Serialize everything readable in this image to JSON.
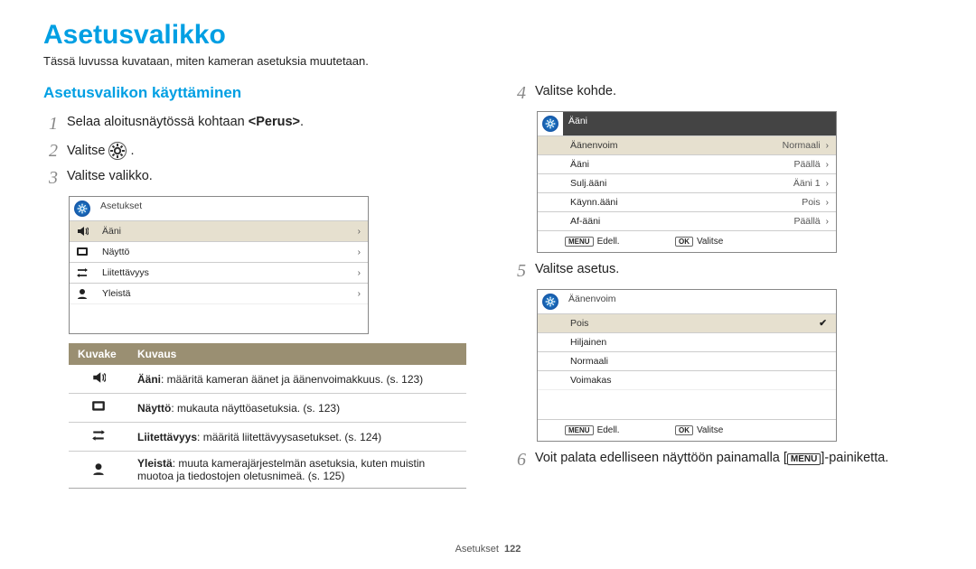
{
  "header": {
    "title": "Asetusvalikko",
    "intro": "Tässä luvussa kuvataan, miten kameran asetuksia muutetaan."
  },
  "section_heading": "Asetusvalikon käyttäminen",
  "steps": {
    "s1_pre": "Selaa aloitusnäytössä kohtaan ",
    "s1_bold": "<Perus>",
    "s1_post": ".",
    "s2_pre": "Valitse ",
    "s2_post": ".",
    "s3": "Valitse valikko.",
    "s4": "Valitse kohde.",
    "s5": "Valitse asetus.",
    "s6_pre": "Voit palata edelliseen näyttöön painamalla [",
    "s6_post": "]-painiketta.",
    "s6_badge": "MENU"
  },
  "cam1": {
    "title": "Asetukset",
    "rows": [
      {
        "label": "Ääni",
        "active": true
      },
      {
        "label": "Näyttö"
      },
      {
        "label": "Liitettävyys"
      },
      {
        "label": "Yleistä"
      }
    ]
  },
  "cam2": {
    "title": "Ääni",
    "rows": [
      {
        "label": "Äänenvoim",
        "value": "Normaali",
        "active": true
      },
      {
        "label": "Ääni",
        "value": "Päällä"
      },
      {
        "label": "Sulj.ääni",
        "value": "Ääni 1"
      },
      {
        "label": "Käynn.ääni",
        "value": "Pois"
      },
      {
        "label": "Af-ääni",
        "value": "Päällä"
      }
    ],
    "footer": {
      "back": "Edell.",
      "ok": "Valitse",
      "back_badge": "MENU",
      "ok_badge": "OK"
    }
  },
  "cam3": {
    "title": "Äänenvoim",
    "rows": [
      {
        "label": "Pois",
        "checked": true
      },
      {
        "label": "Hiljainen"
      },
      {
        "label": "Normaali"
      },
      {
        "label": "Voimakas"
      }
    ],
    "footer": {
      "back": "Edell.",
      "ok": "Valitse",
      "back_badge": "MENU",
      "ok_badge": "OK"
    }
  },
  "table": {
    "h1": "Kuvake",
    "h2": "Kuvaus",
    "rows": [
      {
        "bold": "Ääni",
        "rest": ": määritä kameran äänet ja äänenvoimakkuus. (s. 123)"
      },
      {
        "bold": "Näyttö",
        "rest": ": mukauta näyttöasetuksia. (s. 123)"
      },
      {
        "bold": "Liitettävyys",
        "rest": ": määritä liitettävyysasetukset. (s. 124)"
      },
      {
        "bold": "Yleistä",
        "rest": ": muuta kamerajärjestelmän asetuksia, kuten muistin muotoa ja tiedostojen oletusnimeä. (s. 125)"
      }
    ]
  },
  "footer": {
    "section": "Asetukset",
    "page": "122"
  }
}
